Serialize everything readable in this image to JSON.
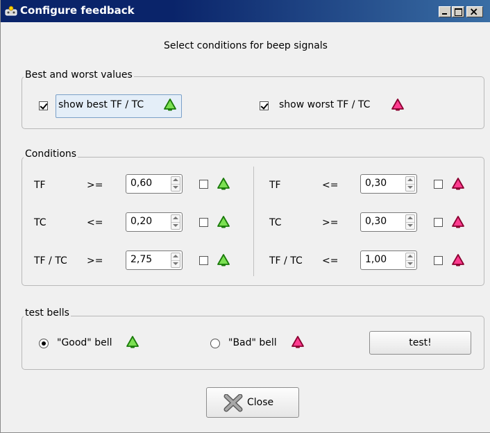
{
  "window": {
    "title": "Configure feedback"
  },
  "heading": "Select conditions for beep signals",
  "best_worst": {
    "label": "Best and worst values",
    "show_best": {
      "label": "show best TF / TC",
      "checked": true
    },
    "show_worst": {
      "label": "show worst TF / TC",
      "checked": true
    }
  },
  "conditions": {
    "label": "Conditions",
    "left": [
      {
        "metric": "TF",
        "op": ">=",
        "value": "0,60",
        "checked": false
      },
      {
        "metric": "TC",
        "op": "<=",
        "value": "0,20",
        "checked": false
      },
      {
        "metric": "TF / TC",
        "op": ">=",
        "value": "2,75",
        "checked": false
      }
    ],
    "right": [
      {
        "metric": "TF",
        "op": "<=",
        "value": "0,30",
        "checked": false
      },
      {
        "metric": "TC",
        "op": ">=",
        "value": "0,30",
        "checked": false
      },
      {
        "metric": "TF / TC",
        "op": "<=",
        "value": "1,00",
        "checked": false
      }
    ]
  },
  "test_bells": {
    "label": "test bells",
    "good": {
      "label": "\"Good\" bell",
      "selected": true
    },
    "bad": {
      "label": "\"Bad\" bell",
      "selected": false
    },
    "test_button": "test!"
  },
  "close_button": "Close",
  "colors": {
    "good_bell": "#44cc22",
    "bad_bell": "#e0206a",
    "title_bar": "#0a246a"
  },
  "icons": {
    "good": "green-bell-icon",
    "bad": "red-bell-icon",
    "close": "close-x-icon"
  }
}
